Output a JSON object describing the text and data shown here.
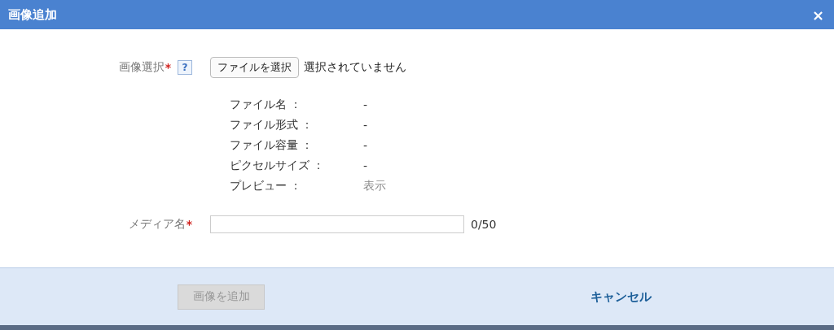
{
  "window": {
    "title": "画像追加",
    "close": "×"
  },
  "image_select": {
    "label": "画像選択",
    "required_mark": "*",
    "help": "?",
    "file_button": "ファイルを選択",
    "file_status": "選択されていません"
  },
  "file_info": [
    {
      "label": "ファイル名 ：",
      "value": "-",
      "kind": "text"
    },
    {
      "label": "ファイル形式 ：",
      "value": "-",
      "kind": "text"
    },
    {
      "label": "ファイル容量 ：",
      "value": "-",
      "kind": "text"
    },
    {
      "label": "ピクセルサイズ ：",
      "value": "-",
      "kind": "text"
    },
    {
      "label": "プレビュー ：",
      "value": "表示",
      "kind": "link"
    }
  ],
  "media_name": {
    "label": "メディア名",
    "required_mark": "*",
    "counter": "0/50"
  },
  "footer": {
    "submit": {
      "label": "画像を追加",
      "disabled": true
    },
    "cancel": "キャンセル"
  }
}
